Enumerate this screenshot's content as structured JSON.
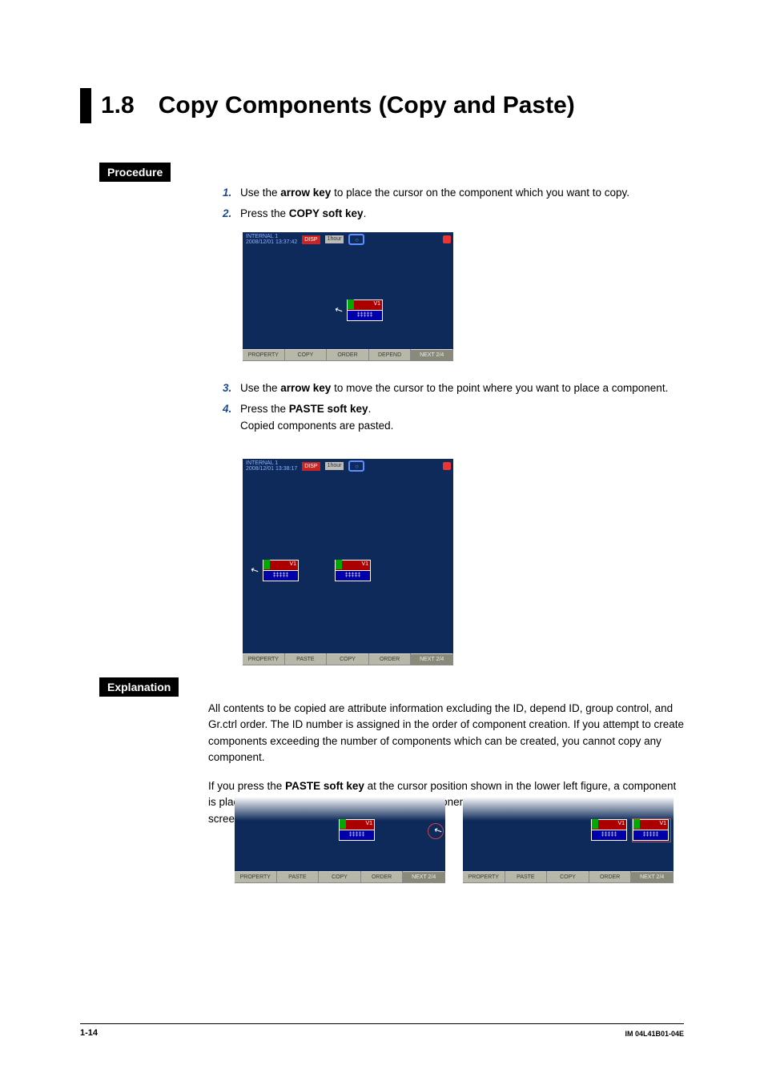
{
  "title": {
    "number": "1.8",
    "text": "Copy Components (Copy and Paste)"
  },
  "sections": {
    "procedure": "Procedure",
    "explanation": "Explanation"
  },
  "steps": {
    "s1": {
      "num": "1.",
      "pre": "Use the ",
      "b": "arrow key",
      "post": " to place the cursor on the component which you want to copy."
    },
    "s2": {
      "num": "2.",
      "pre": "Press the ",
      "b": "COPY soft key",
      "post": "."
    },
    "s3": {
      "num": "3.",
      "pre": "Use the ",
      "b": "arrow key",
      "post": " to move the cursor to the point where you want to place a component."
    },
    "s4": {
      "num": "4.",
      "pre": "Press the ",
      "b": "PASTE soft key",
      "post": ".",
      "sub": "Copied components are pasted."
    }
  },
  "device": {
    "header": {
      "line1": "INTERNAL 1",
      "ts1": "2008/12/01 13:37:42",
      "ts2": "2008/12/01 13:38:17",
      "disp": "DISP",
      "rate": "1hour"
    },
    "component": {
      "vlabel": "V1",
      "value": "‡‡‡‡‡"
    },
    "softkeys1": [
      "PROPERTY",
      "COPY",
      "ORDER",
      "DEPEND",
      "NEXT 2/4"
    ],
    "softkeys2": [
      "PROPERTY",
      "PASTE",
      "COPY",
      "ORDER",
      "NEXT 2/4"
    ]
  },
  "explanation": {
    "p1": "All contents to be copied are attribute information excluding the ID, depend ID, group control, and Gr.ctrl order. The ID number is assigned in the order of component creation. If you attempt to create components exceeding the number of components which can be created, you cannot copy any component.",
    "p2a": "If you press the ",
    "p2b": "PASTE soft key",
    "p2c": " at the cursor position shown in the lower left figure, a component is placed as the lower right figure shows. A component is placed so that it does not go over the screen."
  },
  "footer": {
    "page": "1-14",
    "code": "IM 04L41B01-04E"
  }
}
